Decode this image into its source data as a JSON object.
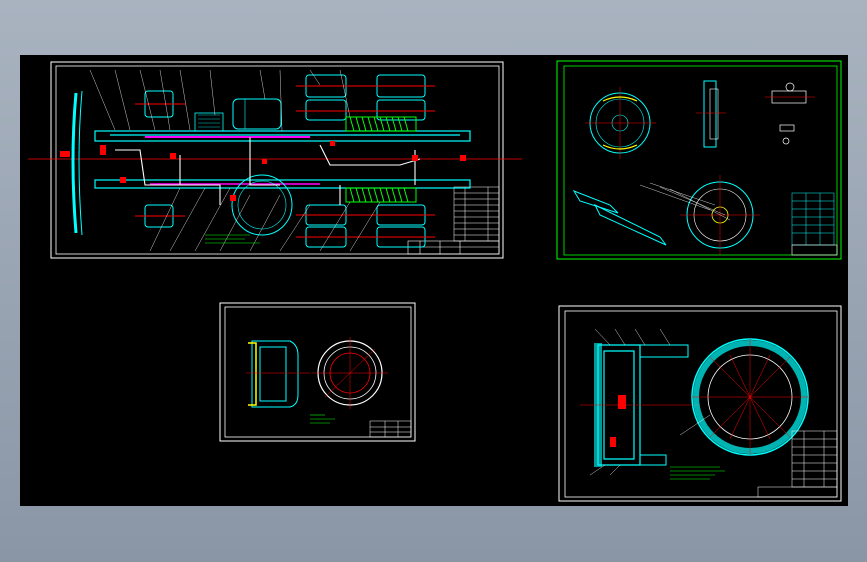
{
  "viewport": {
    "background": "#000000",
    "colors": {
      "frame": "#ffffff",
      "frame_green": "#00ff00",
      "cyan": "#00ffff",
      "red": "#ff0000",
      "yellow": "#ffff00",
      "green": "#00ff00",
      "magenta": "#ff00ff",
      "blue": "#0000ff"
    }
  },
  "sheets": [
    {
      "id": "chassis-layout",
      "frame_color": "white"
    },
    {
      "id": "brake-assembly-views",
      "frame_color": "green"
    },
    {
      "id": "brake-drum",
      "frame_color": "white"
    },
    {
      "id": "brake-section",
      "frame_color": "white"
    }
  ]
}
